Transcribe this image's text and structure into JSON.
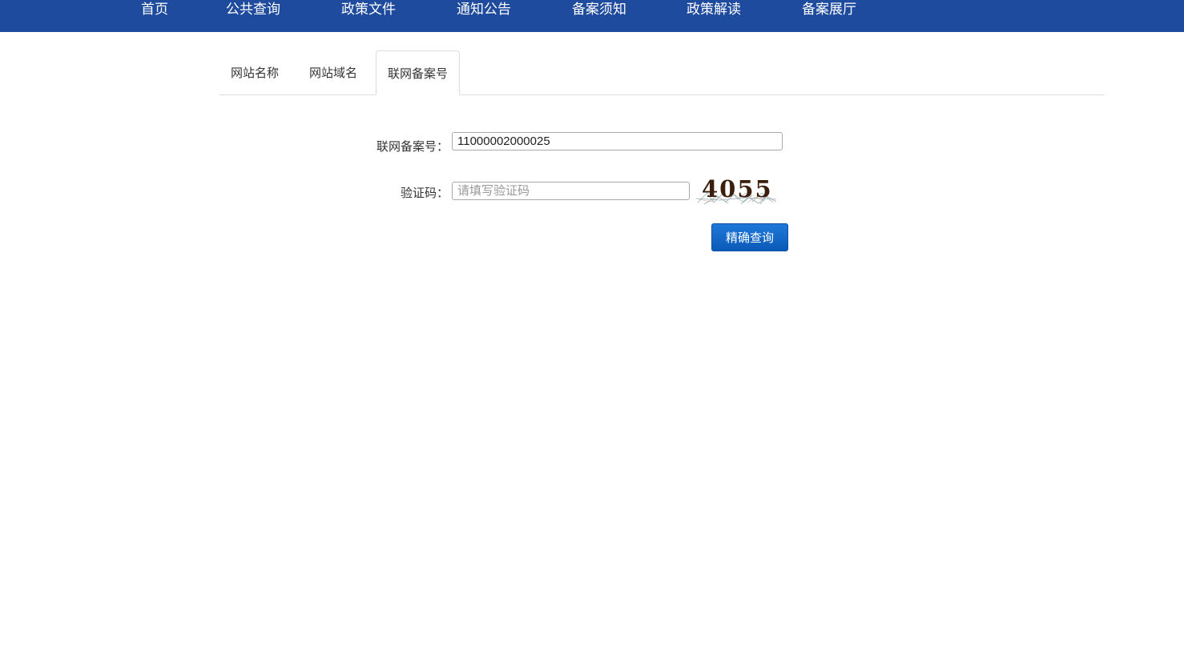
{
  "nav": {
    "items": [
      {
        "label": "首页"
      },
      {
        "label": "公共查询"
      },
      {
        "label": "政策文件"
      },
      {
        "label": "通知公告"
      },
      {
        "label": "备案须知"
      },
      {
        "label": "政策解读"
      },
      {
        "label": "备案展厅"
      }
    ]
  },
  "tabs": [
    {
      "label": "网站名称",
      "active": false
    },
    {
      "label": "网站域名",
      "active": false
    },
    {
      "label": "联网备案号",
      "active": true
    }
  ],
  "form": {
    "record_label": "联网备案号：",
    "record_value": "11000002000025",
    "captcha_label": "验证码：",
    "captcha_placeholder": "请填写验证码",
    "captcha_value": "",
    "captcha_code": "4055",
    "submit_label": "精确查询"
  },
  "colors": {
    "nav_bg": "#1f4b9e",
    "button_bg": "#1466c8"
  }
}
